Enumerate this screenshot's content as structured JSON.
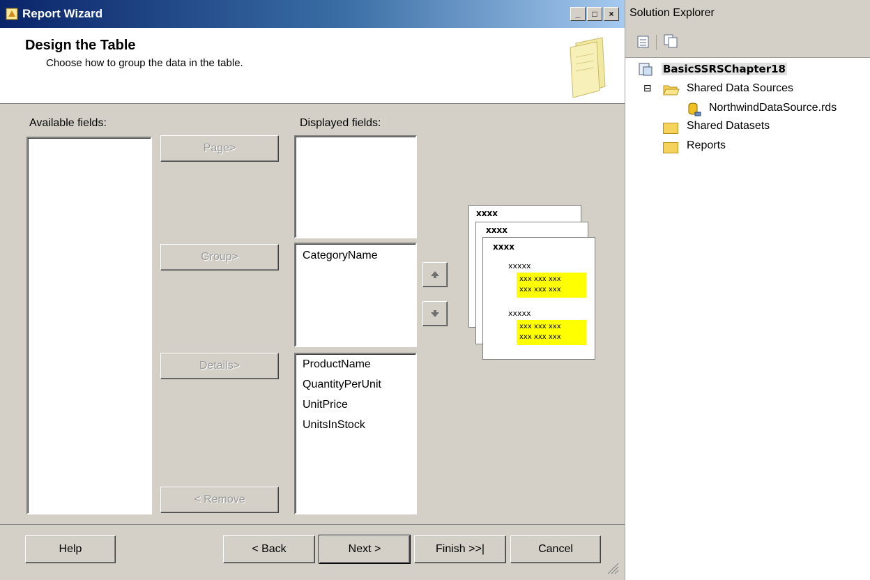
{
  "wizard": {
    "title": "Report Wizard",
    "header_title": "Design the Table",
    "header_subtitle": "Choose how to group the data in the table.",
    "caption_buttons": {
      "minimize": "_",
      "maximize": "□",
      "close": "×"
    },
    "available_label": "Available fields:",
    "displayed_label": "Displayed fields:",
    "page_fields": [],
    "group_fields": [
      "CategoryName"
    ],
    "details_fields": [
      "ProductName",
      "QuantityPerUnit",
      "UnitPrice",
      "UnitsInStock"
    ],
    "buttons": {
      "page": "Page>",
      "group": "Group>",
      "details": "Details>",
      "remove": "< Remove",
      "help": "Help",
      "back": "< Back",
      "next": "Next >",
      "finish": "Finish >>|",
      "cancel": "Cancel"
    },
    "preview": {
      "page_label": "xxxx",
      "group_label": "xxxxx",
      "row": "xxx xxx xxx"
    }
  },
  "solution_explorer": {
    "title": "Solution Explorer",
    "project": "BasicSSRSChapter18",
    "collapse_glyph": "⊟",
    "items": [
      {
        "label": "Shared Data Sources",
        "icon": "folder-open-icon"
      },
      {
        "label": "NorthwindDataSource.rds",
        "icon": "datasource-icon"
      },
      {
        "label": "Shared Datasets",
        "icon": "folder-icon"
      },
      {
        "label": "Reports",
        "icon": "folder-icon"
      }
    ]
  }
}
